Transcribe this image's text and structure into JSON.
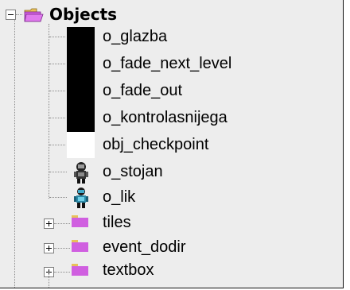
{
  "tree": {
    "root_label": "Objects",
    "objects": [
      {
        "label": "o_glazba",
        "swatch_color": "#000000"
      },
      {
        "label": "o_fade_next_level",
        "swatch_color": "#000000"
      },
      {
        "label": "o_fade_out",
        "swatch_color": "#000000"
      },
      {
        "label": "o_kontrolasnijega",
        "swatch_color": "#000000"
      },
      {
        "label": "obj_checkpoint",
        "swatch_color": "#ffffff"
      },
      {
        "label": "o_stojan",
        "icon": "stojan-sprite-icon"
      },
      {
        "label": "o_lik",
        "icon": "lik-sprite-icon"
      }
    ],
    "groups": [
      {
        "label": "tiles"
      },
      {
        "label": "event_dodir"
      },
      {
        "label": "textbox"
      }
    ]
  },
  "colors": {
    "panel_bg": "#ededed",
    "folder_purple": "#d05fe0",
    "folder_yellow": "#e8c15a"
  }
}
